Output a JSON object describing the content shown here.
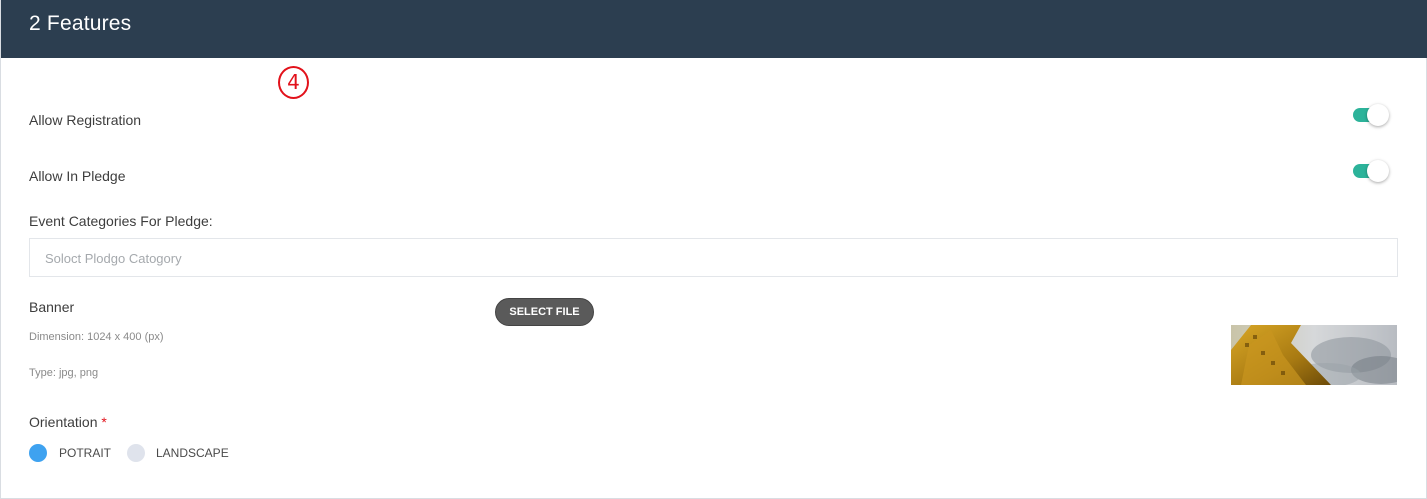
{
  "header": {
    "title": "2 Features"
  },
  "annotation": {
    "badge": "4"
  },
  "settings": {
    "allow_registration": {
      "label": "Allow Registration",
      "enabled": true
    },
    "allow_in_pledge": {
      "label": "Allow In Pledge",
      "enabled": true
    }
  },
  "categories": {
    "label": "Event Categories For Pledge:",
    "placeholder": "Soloct Plodgo Catogory"
  },
  "banner": {
    "label": "Banner",
    "dimension": "Dimension: 1024 x 400 (px)",
    "type": "Type: jpg, png",
    "select_button": "SELECT FILE"
  },
  "orientation": {
    "label": "Orientation",
    "required_mark": "*",
    "options": [
      {
        "label": "POTRAIT",
        "selected": true
      },
      {
        "label": "LANDSCAPE",
        "selected": false
      }
    ]
  },
  "colors": {
    "header_bg": "#2c3e50",
    "toggle_on": "#2cb39a",
    "radio_selected": "#3ea2f0",
    "annotation": "#e2121b"
  }
}
